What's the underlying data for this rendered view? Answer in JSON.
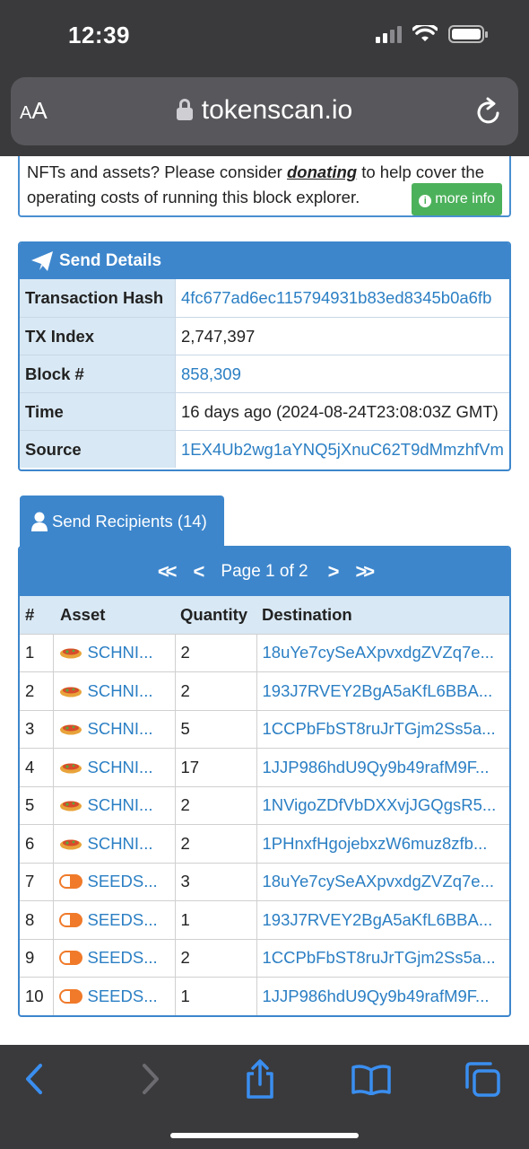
{
  "status_bar": {
    "time": "12:39"
  },
  "browser": {
    "aa_label_big": "A",
    "aa_label_small": "A",
    "url": "tokenscan.io"
  },
  "notice": {
    "text_before": "NFTs and assets? Please consider ",
    "link": "donating",
    "text_after": " to help cover the operating costs of running this block explorer.",
    "button": "more info"
  },
  "send_details": {
    "title": "Send Details",
    "rows": [
      {
        "key": "Transaction Hash",
        "value": "4fc677ad6ec115794931b83ed8345b0a6fb",
        "link": true
      },
      {
        "key": "TX Index",
        "value": "2,747,397",
        "link": false
      },
      {
        "key": "Block #",
        "value": "858,309",
        "link": true
      },
      {
        "key": "Time",
        "value": "16 days ago (2024-08-24T23:08:03Z GMT)",
        "link": false
      },
      {
        "key": "Source",
        "value": "1EX4Ub2wg1aYNQ5jXnuC62T9dMmzhfVm",
        "link": true
      }
    ]
  },
  "recipients": {
    "tab_label": "Send Recipients (14)",
    "pager": {
      "first": "<<",
      "prev": "<",
      "label": "Page 1 of 2",
      "next": ">",
      "last": ">>"
    },
    "columns": [
      "#",
      "Asset",
      "Quantity",
      "Destination"
    ],
    "rows": [
      {
        "n": "1",
        "icon": "schni",
        "asset": "SCHNI...",
        "qty": "2",
        "dest": "18uYe7cySeAXpvxdgZVZq7e..."
      },
      {
        "n": "2",
        "icon": "schni",
        "asset": "SCHNI...",
        "qty": "2",
        "dest": "193J7RVEY2BgA5aKfL6BBA..."
      },
      {
        "n": "3",
        "icon": "schni",
        "asset": "SCHNI...",
        "qty": "5",
        "dest": "1CCPbFbST8ruJrTGjm2Ss5a..."
      },
      {
        "n": "4",
        "icon": "schni",
        "asset": "SCHNI...",
        "qty": "17",
        "dest": "1JJP986hdU9Qy9b49rafM9F..."
      },
      {
        "n": "5",
        "icon": "schni",
        "asset": "SCHNI...",
        "qty": "2",
        "dest": "1NVigoZDfVbDXXvjJGQgsR5..."
      },
      {
        "n": "6",
        "icon": "schni",
        "asset": "SCHNI...",
        "qty": "2",
        "dest": "1PHnxfHgojebxzW6muz8zfb..."
      },
      {
        "n": "7",
        "icon": "seeds",
        "asset": "SEEDS...",
        "qty": "3",
        "dest": "18uYe7cySeAXpvxdgZVZq7e..."
      },
      {
        "n": "8",
        "icon": "seeds",
        "asset": "SEEDS...",
        "qty": "1",
        "dest": "193J7RVEY2BgA5aKfL6BBA..."
      },
      {
        "n": "9",
        "icon": "seeds",
        "asset": "SEEDS...",
        "qty": "2",
        "dest": "1CCPbFbST8ruJrTGjm2Ss5a..."
      },
      {
        "n": "10",
        "icon": "seeds",
        "asset": "SEEDS...",
        "qty": "1",
        "dest": "1JJP986hdU9Qy9b49rafM9F..."
      }
    ]
  },
  "toolbar": {
    "icons": [
      "back-icon",
      "forward-icon",
      "share-icon",
      "bookmarks-icon",
      "tabs-icon"
    ]
  },
  "colors": {
    "accent": "#3d86cc",
    "link": "#2b7fc4",
    "header_bg": "#d8e8f4",
    "chrome": "#3a3a3c",
    "more_info": "#4cb15b"
  }
}
